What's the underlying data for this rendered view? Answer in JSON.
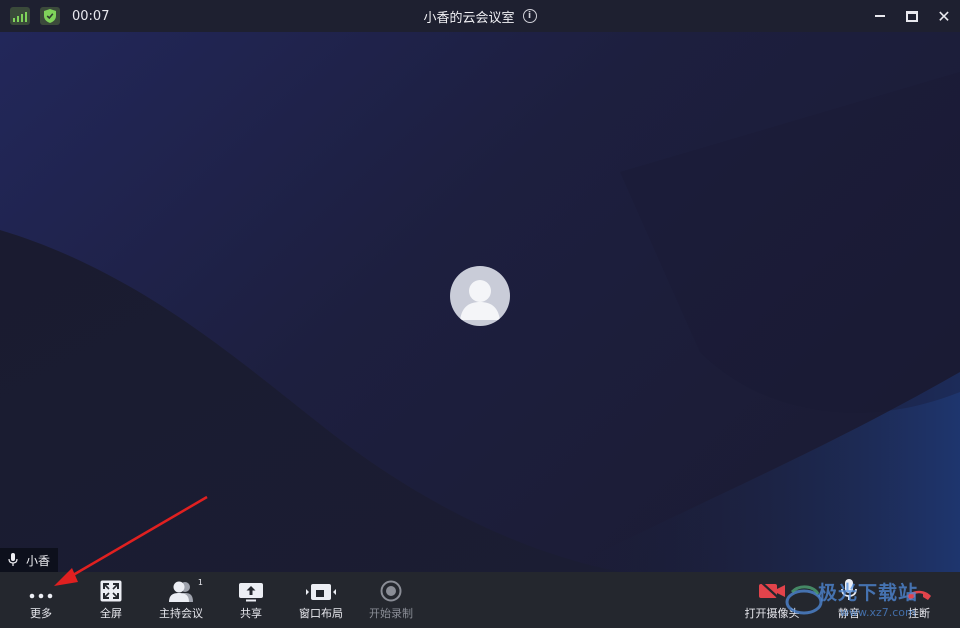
{
  "titlebar": {
    "timer": "00:07",
    "meeting_title": "小香的云会议室",
    "info_glyph": "i",
    "icons": [
      "signal-icon",
      "shield-icon",
      "info-icon",
      "minimize-icon",
      "maximize-icon",
      "close-icon"
    ]
  },
  "stage": {
    "speaker_name": "小香"
  },
  "toolbar": {
    "more": "更多",
    "fullscreen": "全屏",
    "host": "主持会议",
    "host_badge": "1",
    "share": "共享",
    "layout": "窗口布局",
    "record": "开始录制",
    "camera": "打开摄像头",
    "mute": "静音",
    "hangup": "挂断"
  },
  "watermark": {
    "text": "极光下载站",
    "url": "www.xz7.com"
  },
  "colors": {
    "titlebar_bg": "#1e2030",
    "toolbar_bg": "#24272e",
    "stage_bg": "#1c1d36",
    "camera_off_red": "#e2434b",
    "hangup_red": "#e2434b",
    "annotation_arrow": "#e02020"
  }
}
